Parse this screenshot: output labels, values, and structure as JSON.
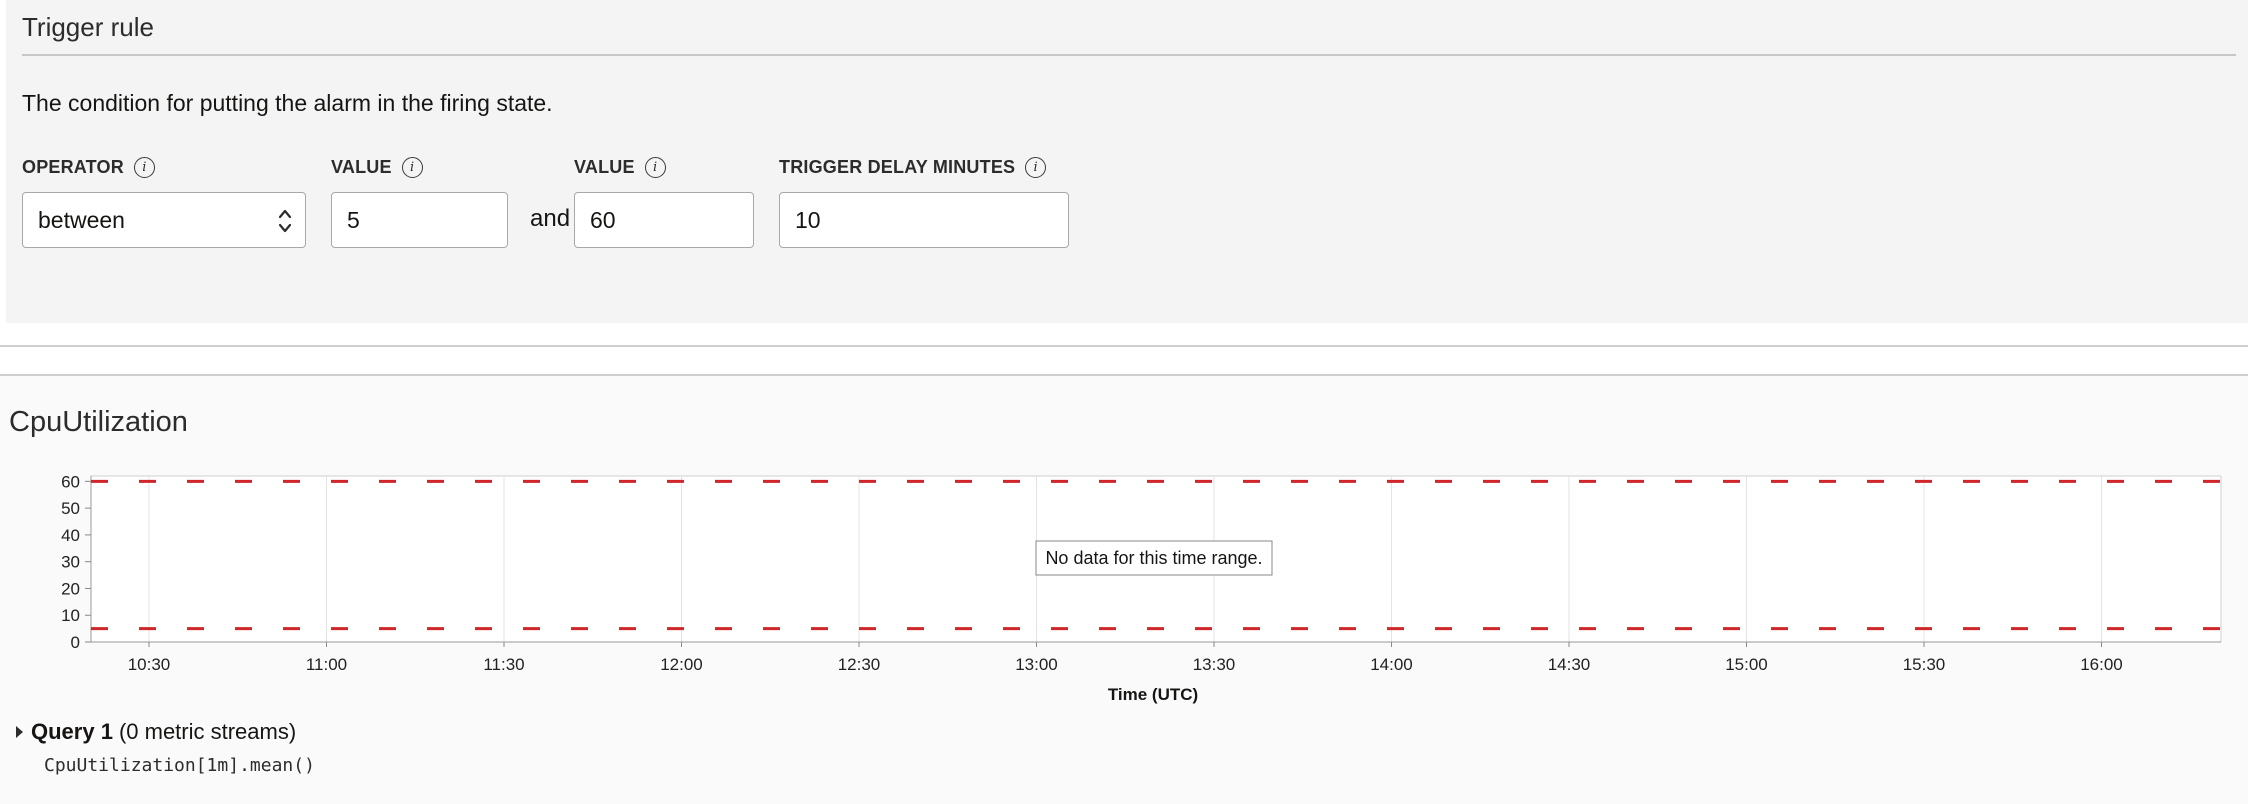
{
  "trigger_rule": {
    "title": "Trigger rule",
    "description": "The condition for putting the alarm in the firing state.",
    "operator": {
      "label": "OPERATOR",
      "value": "between"
    },
    "value1": {
      "label": "VALUE",
      "value": "5"
    },
    "and_label": "and",
    "value2": {
      "label": "VALUE",
      "value": "60"
    },
    "trigger_delay": {
      "label": "TRIGGER DELAY MINUTES",
      "value": "10"
    },
    "info_glyph": "i"
  },
  "chart_section": {
    "title": "CpuUtilization",
    "query": {
      "name": "Query 1",
      "streams": "(0 metric streams)",
      "expression": "CpuUtilization[1m].mean()"
    }
  },
  "chart_data": {
    "type": "line",
    "title": "",
    "xlabel": "Time (UTC)",
    "ylabel": "",
    "x_ticks": [
      "10:30",
      "11:00",
      "11:30",
      "12:00",
      "12:30",
      "13:00",
      "13:30",
      "14:00",
      "14:30",
      "15:00",
      "15:30",
      "16:00"
    ],
    "y_ticks": [
      0,
      10,
      20,
      30,
      40,
      50,
      60
    ],
    "ylim": [
      0,
      62
    ],
    "grid": true,
    "series": [],
    "thresholds": [
      5,
      60
    ],
    "threshold_color": "#d0262a",
    "message": "No data for this time range."
  }
}
